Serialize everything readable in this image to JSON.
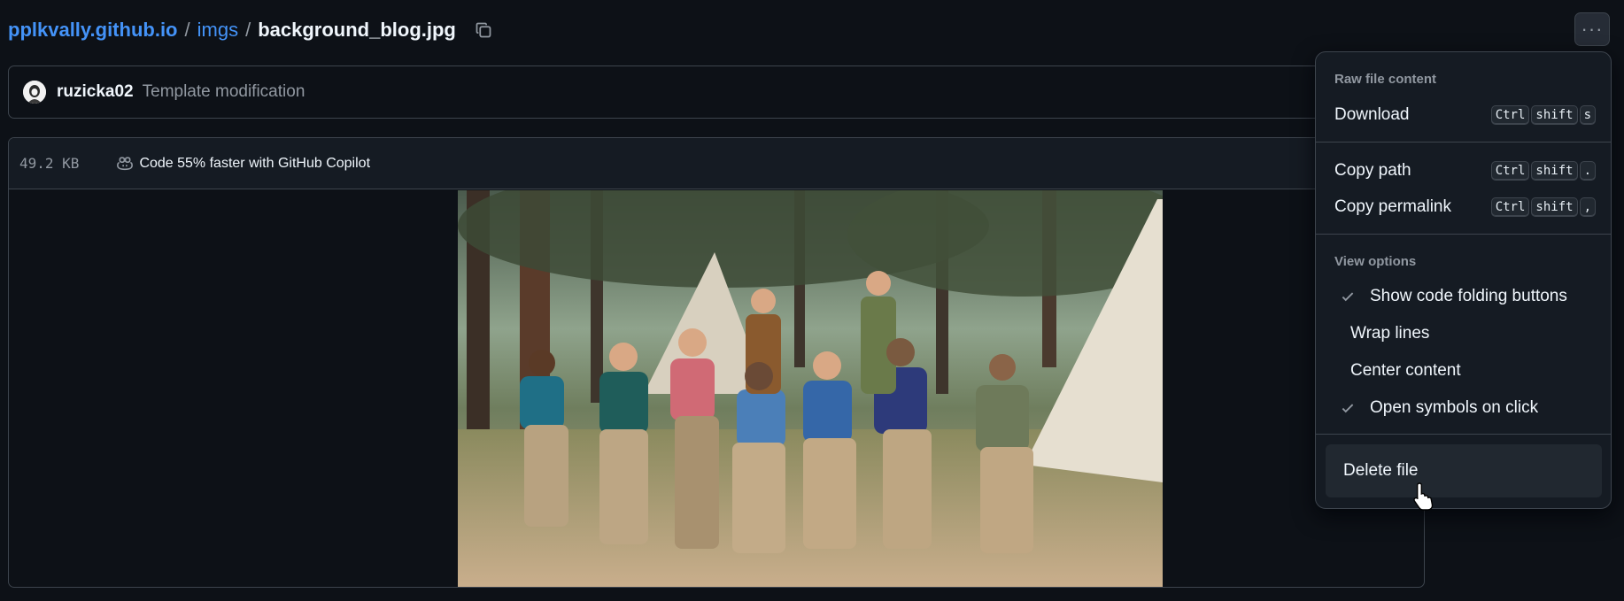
{
  "breadcrumb": {
    "repo": "pplkvally.github.io",
    "separator1": "/",
    "folder": "imgs",
    "separator2": "/",
    "file": "background_blog.jpg"
  },
  "icons": {
    "copy_path": "copy-icon",
    "more": "kebab-horizontal-icon",
    "copilot": "copilot-icon",
    "check": "check-icon"
  },
  "commit": {
    "author": "ruzicka02",
    "message": "Template modification"
  },
  "file": {
    "size": "49.2 KB",
    "copilot_promo": "Code 55% faster with GitHub Copilot"
  },
  "menu": {
    "more_button_label": "···",
    "raw_heading": "Raw file content",
    "download": {
      "label": "Download",
      "keys": [
        "Ctrl",
        "shift",
        "s"
      ]
    },
    "copy_path": {
      "label": "Copy path",
      "keys": [
        "Ctrl",
        "shift",
        "."
      ]
    },
    "copy_permalink": {
      "label": "Copy permalink",
      "keys": [
        "Ctrl",
        "shift",
        ","
      ]
    },
    "view_heading": "View options",
    "view_options": [
      {
        "label": "Show code folding buttons",
        "checked": true
      },
      {
        "label": "Wrap lines",
        "checked": false
      },
      {
        "label": "Center content",
        "checked": false
      },
      {
        "label": "Open symbols on click",
        "checked": true
      }
    ],
    "delete": "Delete file"
  },
  "colors": {
    "background": "#0d1117",
    "link": "#4493f8",
    "border": "#3d444d",
    "muted": "#9198a1"
  }
}
